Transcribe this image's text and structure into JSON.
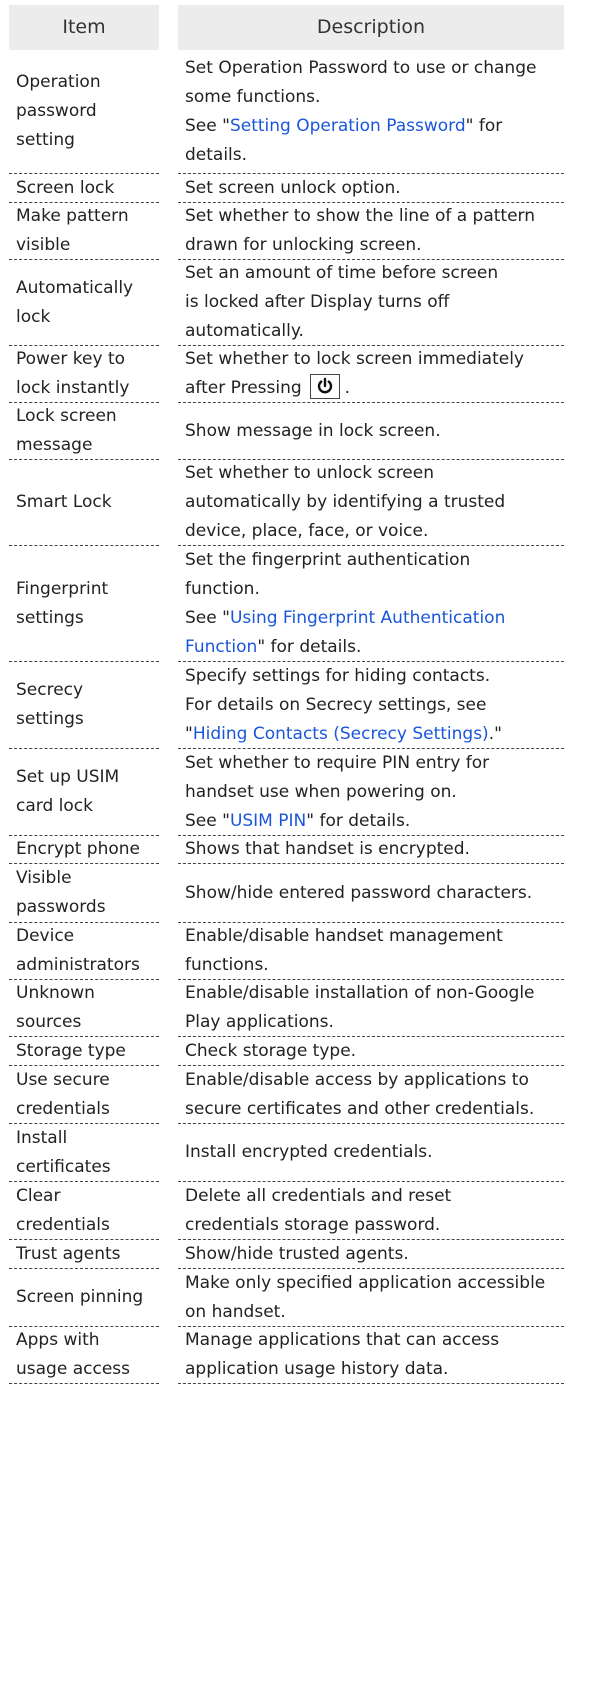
{
  "header": {
    "item": "Item",
    "description": "Description"
  },
  "rows": [
    {
      "item": [
        "Operation",
        "password",
        "setting"
      ],
      "desc": [
        [
          {
            "t": "Set Operation Password to use or change"
          }
        ],
        [
          {
            "t": "some functions."
          }
        ],
        [
          {
            "t": "See \""
          },
          {
            "t": "Setting Operation Password",
            "link": true
          },
          {
            "t": "\" for"
          }
        ],
        [
          {
            "t": "details."
          }
        ]
      ]
    },
    {
      "item": [
        "Screen lock"
      ],
      "desc": [
        [
          {
            "t": "Set screen unlock option."
          }
        ]
      ]
    },
    {
      "item": [
        "Make pattern",
        "visible"
      ],
      "desc": [
        [
          {
            "t": "Set whether to show the line of a pattern"
          }
        ],
        [
          {
            "t": "drawn for unlocking screen."
          }
        ]
      ]
    },
    {
      "item": [
        "Automatically",
        "lock"
      ],
      "desc": [
        [
          {
            "t": "Set an amount of time before screen"
          }
        ],
        [
          {
            "t": "is locked after Display turns off"
          }
        ],
        [
          {
            "t": "automatically."
          }
        ]
      ]
    },
    {
      "item": [
        "Power key to",
        "lock instantly"
      ],
      "desc": [
        [
          {
            "t": "Set whether to lock screen immediately"
          }
        ],
        [
          {
            "t": "after Pressing"
          },
          {
            "key": "power-icon"
          },
          {
            "t": "."
          }
        ]
      ]
    },
    {
      "item": [
        "Lock screen",
        "message"
      ],
      "desc": [
        [
          {
            "t": "Show message in lock screen."
          }
        ]
      ]
    },
    {
      "item": [
        "Smart Lock"
      ],
      "desc": [
        [
          {
            "t": "Set whether to unlock screen"
          }
        ],
        [
          {
            "t": "automatically by identifying a trusted"
          }
        ],
        [
          {
            "t": "device, place, face, or voice."
          }
        ]
      ]
    },
    {
      "item": [
        "Fingerprint",
        "settings"
      ],
      "desc": [
        [
          {
            "t": "Set the fingerprint authentication"
          }
        ],
        [
          {
            "t": "function."
          }
        ],
        [
          {
            "t": "See \""
          },
          {
            "t": "Using Fingerprint Authentication",
            "link": true
          }
        ],
        [
          {
            "t": "Function",
            "link": true
          },
          {
            "t": "\" for details."
          }
        ]
      ]
    },
    {
      "item": [
        "Secrecy",
        "settings"
      ],
      "desc": [
        [
          {
            "t": "Specify settings for hiding contacts."
          }
        ],
        [
          {
            "t": "For details on Secrecy settings, see"
          }
        ],
        [
          {
            "t": "\""
          },
          {
            "t": "Hiding Contacts (Secrecy Settings)",
            "link": true
          },
          {
            "t": ".\""
          }
        ]
      ]
    },
    {
      "item": [
        "Set up USIM",
        "card lock"
      ],
      "desc": [
        [
          {
            "t": "Set whether to require PIN entry for"
          }
        ],
        [
          {
            "t": "handset use when powering on."
          }
        ],
        [
          {
            "t": "See \""
          },
          {
            "t": "USIM PIN",
            "link": true
          },
          {
            "t": "\" for details."
          }
        ]
      ]
    },
    {
      "item": [
        "Encrypt phone"
      ],
      "desc": [
        [
          {
            "t": "Shows that handset is encrypted."
          }
        ]
      ]
    },
    {
      "item": [
        "Visible",
        "passwords"
      ],
      "desc": [
        [
          {
            "t": "Show/hide entered password characters."
          }
        ]
      ]
    },
    {
      "item": [
        "Device",
        "administrators"
      ],
      "desc": [
        [
          {
            "t": "Enable/disable handset management"
          }
        ],
        [
          {
            "t": "functions."
          }
        ]
      ]
    },
    {
      "item": [
        "Unknown",
        "sources"
      ],
      "desc": [
        [
          {
            "t": "Enable/disable installation of non-Google"
          }
        ],
        [
          {
            "t": "Play applications."
          }
        ]
      ]
    },
    {
      "item": [
        "Storage type"
      ],
      "desc": [
        [
          {
            "t": "Check storage type."
          }
        ]
      ]
    },
    {
      "item": [
        "Use secure",
        "credentials"
      ],
      "desc": [
        [
          {
            "t": "Enable/disable access by applications to"
          }
        ],
        [
          {
            "t": "secure certificates and other credentials."
          }
        ]
      ]
    },
    {
      "item": [
        "Install",
        "certificates"
      ],
      "desc": [
        [
          {
            "t": "Install encrypted credentials."
          }
        ]
      ]
    },
    {
      "item": [
        "Clear",
        "credentials"
      ],
      "desc": [
        [
          {
            "t": "Delete all credentials and reset"
          }
        ],
        [
          {
            "t": "credentials storage password."
          }
        ]
      ]
    },
    {
      "item": [
        "Trust agents"
      ],
      "desc": [
        [
          {
            "t": "Show/hide trusted agents."
          }
        ]
      ]
    },
    {
      "item": [
        "Screen pinning"
      ],
      "desc": [
        [
          {
            "t": "Make only specified application accessible"
          }
        ],
        [
          {
            "t": "on handset."
          }
        ]
      ]
    },
    {
      "item": [
        "Apps with",
        "usage access"
      ],
      "desc": [
        [
          {
            "t": "Manage applications that can access"
          }
        ],
        [
          {
            "t": "application usage history data."
          }
        ]
      ]
    }
  ]
}
